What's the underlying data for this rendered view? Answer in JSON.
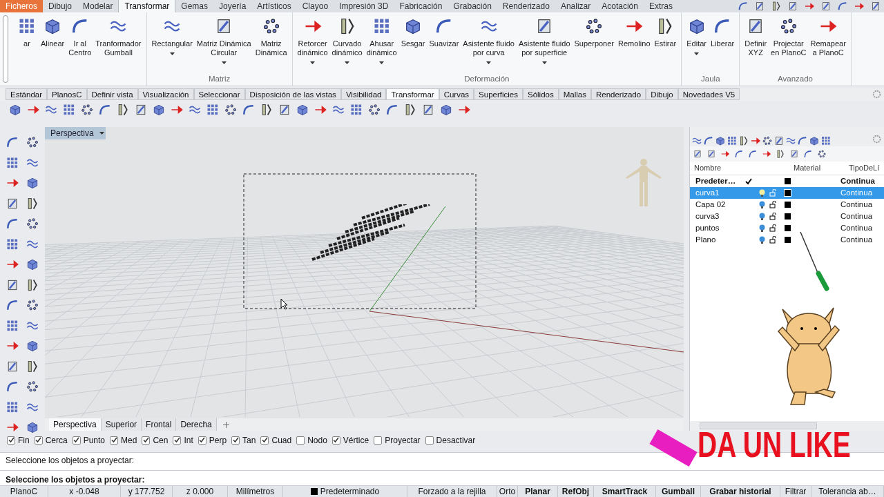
{
  "menu_tabs": [
    {
      "label": "Ficheros",
      "kind": "file",
      "selected": false
    },
    {
      "label": "Dibujo",
      "kind": "tab",
      "selected": false
    },
    {
      "label": "Modelar",
      "kind": "tab",
      "selected": false
    },
    {
      "label": "Transformar",
      "kind": "tab",
      "selected": true
    },
    {
      "label": "Gemas",
      "kind": "tab",
      "selected": false
    },
    {
      "label": "Joyería",
      "kind": "tab",
      "selected": false
    },
    {
      "label": "Artísticos",
      "kind": "tab",
      "selected": false
    },
    {
      "label": "Clayoo",
      "kind": "tab",
      "selected": false
    },
    {
      "label": "Impresión 3D",
      "kind": "tab",
      "selected": false
    },
    {
      "label": "Fabricación",
      "kind": "tab",
      "selected": false
    },
    {
      "label": "Grabación",
      "kind": "tab",
      "selected": false
    },
    {
      "label": "Renderizado",
      "kind": "tab",
      "selected": false
    },
    {
      "label": "Analizar",
      "kind": "tab",
      "selected": false
    },
    {
      "label": "Acotación",
      "kind": "tab",
      "selected": false
    },
    {
      "label": "Extras",
      "kind": "tab",
      "selected": false
    }
  ],
  "ribbon_groups": [
    {
      "buttons": [
        {
          "label": "ar",
          "dropdown": false
        },
        {
          "label": "Alinear",
          "dropdown": false
        },
        {
          "label": "Ir al\nCentro",
          "dropdown": false
        },
        {
          "label": "Tranformador\nGumball",
          "dropdown": false
        }
      ]
    },
    {
      "label": "Matriz",
      "buttons": [
        {
          "label": "Rectangular",
          "dropdown": true
        },
        {
          "label": "Matriz Dinámica\nCircular",
          "dropdown": true
        },
        {
          "label": "Matriz\nDinámica",
          "dropdown": false
        }
      ]
    },
    {
      "label": "Deformación",
      "buttons": [
        {
          "label": "Retorcer\ndinámico",
          "dropdown": true
        },
        {
          "label": "Curvado\ndinámico",
          "dropdown": true
        },
        {
          "label": "Ahusar\ndinámico",
          "dropdown": true
        },
        {
          "label": "Sesgar",
          "dropdown": false
        },
        {
          "label": "Suavizar",
          "dropdown": false
        },
        {
          "label": "Asistente fluido\npor curva",
          "dropdown": true
        },
        {
          "label": "Asistente fluido\npor superficie",
          "dropdown": true
        },
        {
          "label": "Superponer",
          "dropdown": false
        },
        {
          "label": "Remolino",
          "dropdown": false
        },
        {
          "label": "Estirar",
          "dropdown": false
        }
      ]
    },
    {
      "label": "Jaula",
      "buttons": [
        {
          "label": "Editar",
          "dropdown": true
        },
        {
          "label": "Liberar",
          "dropdown": false
        }
      ]
    },
    {
      "label": "Avanzado",
      "buttons": [
        {
          "label": "Definir\nXYZ",
          "dropdown": false
        },
        {
          "label": "Projectar\nen PlanoC",
          "dropdown": false
        },
        {
          "label": "Remapear\na PlanoC",
          "dropdown": false
        }
      ]
    }
  ],
  "toolbar_tabs": [
    {
      "label": "Estándar",
      "selected": false
    },
    {
      "label": "PlanosC",
      "selected": false
    },
    {
      "label": "Definir vista",
      "selected": false
    },
    {
      "label": "Visualización",
      "selected": false
    },
    {
      "label": "Seleccionar",
      "selected": false
    },
    {
      "label": "Disposición de las vistas",
      "selected": false
    },
    {
      "label": "Visibilidad",
      "selected": false
    },
    {
      "label": "Transformar",
      "selected": true
    },
    {
      "label": "Curvas",
      "selected": false
    },
    {
      "label": "Superficies",
      "selected": false
    },
    {
      "label": "Sólidos",
      "selected": false
    },
    {
      "label": "Mallas",
      "selected": false
    },
    {
      "label": "Renderizado",
      "selected": false
    },
    {
      "label": "Dibujo",
      "selected": false
    },
    {
      "label": "Novedades V5",
      "selected": false
    }
  ],
  "viewport": {
    "title": "Perspectiva"
  },
  "viewport_tabs": [
    {
      "label": "Perspectiva",
      "selected": true
    },
    {
      "label": "Superior",
      "selected": false
    },
    {
      "label": "Frontal",
      "selected": false
    },
    {
      "label": "Derecha",
      "selected": false
    }
  ],
  "layers": {
    "columns": [
      "Nombre",
      "Material",
      "TipoDeLí"
    ],
    "rows": [
      {
        "name": "Predeter…",
        "current": true,
        "selected": false,
        "color": "#000000",
        "linetype": "Continua"
      },
      {
        "name": "curva1",
        "current": false,
        "selected": true,
        "color": "#000000",
        "linetype": "Continua"
      },
      {
        "name": "Capa 02",
        "current": false,
        "selected": false,
        "color": "#000000",
        "linetype": "Continua"
      },
      {
        "name": "curva3",
        "current": false,
        "selected": false,
        "color": "#000000",
        "linetype": "Continua"
      },
      {
        "name": "puntos",
        "current": false,
        "selected": false,
        "color": "#000000",
        "linetype": "Continua"
      },
      {
        "name": "Plano",
        "current": false,
        "selected": false,
        "color": "#000000",
        "linetype": "Continua"
      }
    ]
  },
  "osnaps": [
    {
      "label": "Fin",
      "checked": true
    },
    {
      "label": "Cerca",
      "checked": true
    },
    {
      "label": "Punto",
      "checked": true
    },
    {
      "label": "Med",
      "checked": true
    },
    {
      "label": "Cen",
      "checked": true
    },
    {
      "label": "Int",
      "checked": true
    },
    {
      "label": "Perp",
      "checked": true
    },
    {
      "label": "Tan",
      "checked": true
    },
    {
      "label": "Cuad",
      "checked": true
    },
    {
      "label": "Nodo",
      "checked": false
    },
    {
      "label": "Vértice",
      "checked": true
    },
    {
      "label": "Proyectar",
      "checked": false
    },
    {
      "label": "Desactivar",
      "checked": false
    }
  ],
  "command": {
    "history": "Seleccione los objetos a proyectar:",
    "prompt": "Seleccione los objetos a proyectar:"
  },
  "status_bar": [
    {
      "label": "PlanoC",
      "kind": "text"
    },
    {
      "label": "x -0.048",
      "kind": "text"
    },
    {
      "label": "y 177.752",
      "kind": "text"
    },
    {
      "label": "z 0.000",
      "kind": "text"
    },
    {
      "label": "Milímetros",
      "kind": "text"
    },
    {
      "label": "Predeterminado",
      "kind": "layer",
      "color": "#000000"
    },
    {
      "label": "Forzado a la rejilla",
      "kind": "toggle",
      "on": false
    },
    {
      "label": "Orto",
      "kind": "toggle",
      "on": false
    },
    {
      "label": "Planar",
      "kind": "toggle",
      "on": true
    },
    {
      "label": "RefObj",
      "kind": "toggle",
      "on": true
    },
    {
      "label": "SmartTrack",
      "kind": "toggle",
      "on": true
    },
    {
      "label": "Gumball",
      "kind": "toggle",
      "on": true
    },
    {
      "label": "Grabar historial",
      "kind": "toggle",
      "on": true
    },
    {
      "label": "Filtrar",
      "kind": "toggle",
      "on": false
    },
    {
      "label": "Tolerancia ab…",
      "kind": "text"
    }
  ],
  "overlay": {
    "text": "DA UN LIKE"
  }
}
